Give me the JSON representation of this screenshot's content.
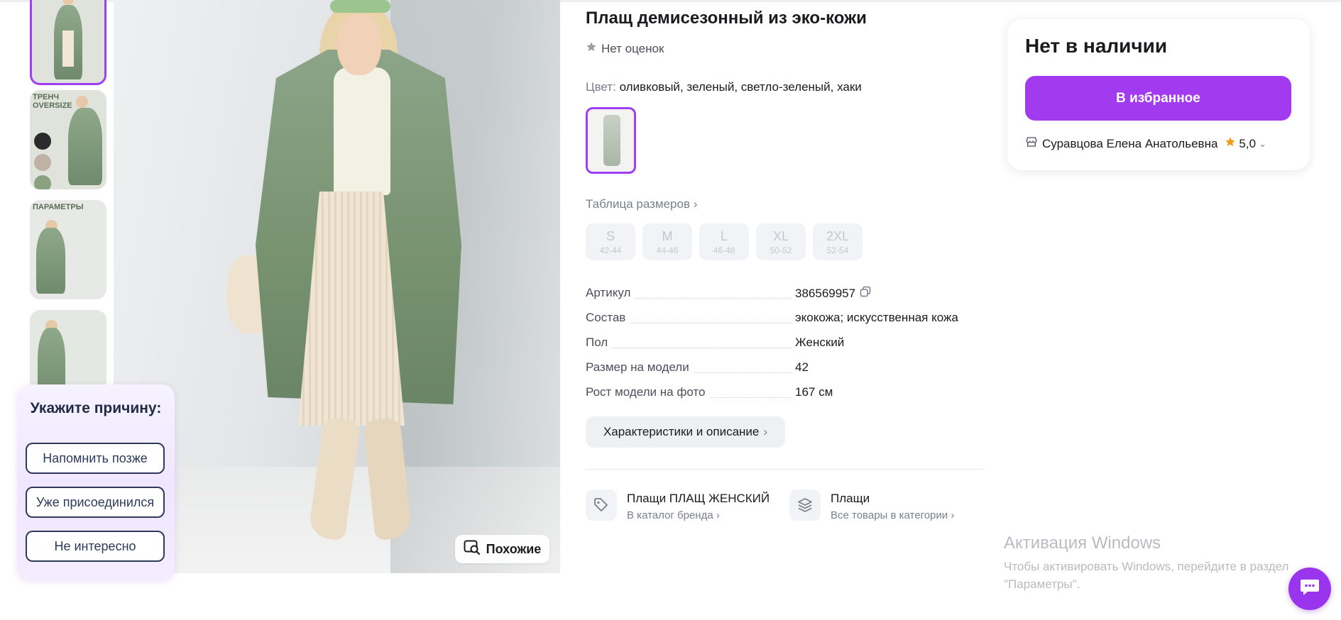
{
  "thumbnails": [
    {
      "label": "",
      "active": true
    },
    {
      "label": "ТРЕНЧ\nOVERSIZE",
      "active": false
    },
    {
      "label": "ПАРАМЕТРЫ",
      "active": false
    },
    {
      "label": "",
      "active": false
    }
  ],
  "similar_button": {
    "label": "Похожие"
  },
  "reason_popup": {
    "title": "Укажите причину:",
    "options": [
      "Напомнить позже",
      "Уже присоединился",
      "Не интересно"
    ]
  },
  "product": {
    "title": "Плащ демисезонный из эко-кожи",
    "rating_text": "Нет оценок",
    "color_label": "Цвет:",
    "color_value": "оливковый, зеленый, светло-зеленый, хаки",
    "size_table_link": "Таблица размеров",
    "sizes": [
      {
        "size": "S",
        "range": "42-44"
      },
      {
        "size": "M",
        "range": "44-46"
      },
      {
        "size": "L",
        "range": "46-48"
      },
      {
        "size": "XL",
        "range": "50-52"
      },
      {
        "size": "2XL",
        "range": "52-54"
      }
    ],
    "specs": [
      {
        "label": "Артикул",
        "value": "386569957"
      },
      {
        "label": "Состав",
        "value": "экокожа; искусственная кожа"
      },
      {
        "label": "Пол",
        "value": "Женский"
      },
      {
        "label": "Размер на модели",
        "value": "42"
      },
      {
        "label": "Рост модели на фото",
        "value": "167 см"
      }
    ],
    "char_button": "Характеристики и описание",
    "brand_link": {
      "main": "Плащи ПЛАЩ ЖЕНСКИЙ",
      "sub": "В каталог бренда"
    },
    "category_link": {
      "main": "Плащи",
      "sub": "Все товары в категории"
    }
  },
  "buybox": {
    "stock_status": "Нет в наличии",
    "favorite_button": "В избранное",
    "seller_name": "Суравцова Елена Анатольевна",
    "seller_rating": "5,0"
  },
  "windows_watermark": {
    "title": "Активация Windows",
    "text": "Чтобы активировать Windows, перейдите в раздел \"Параметры\"."
  },
  "colors": {
    "accent": "#a23af0",
    "popup_border": "#2d3a5a",
    "star_orange": "#f39a1b"
  }
}
